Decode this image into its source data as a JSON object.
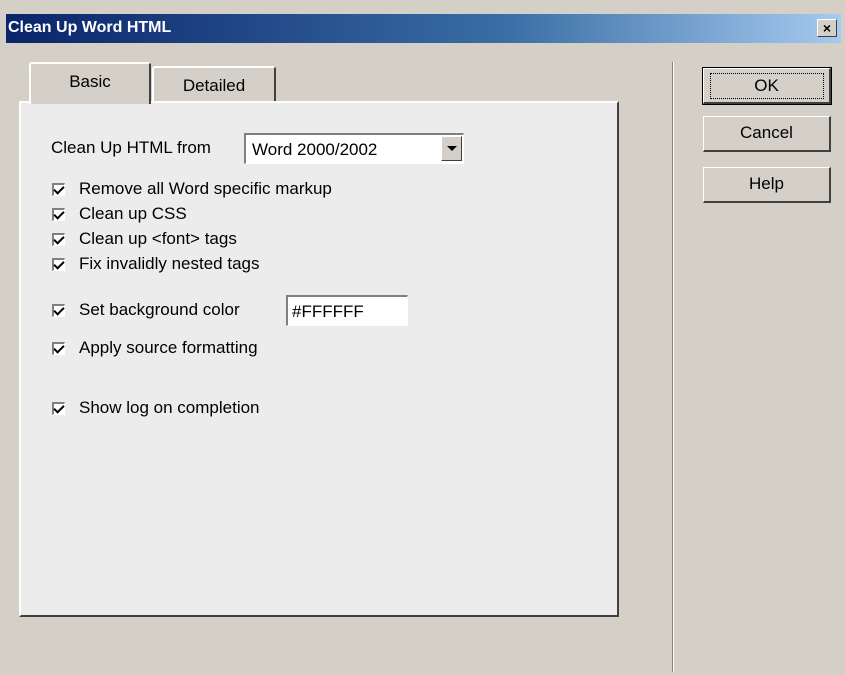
{
  "dialog": {
    "title": "Clean Up Word HTML",
    "close_label": "×"
  },
  "tabs": [
    {
      "label": "Basic",
      "active": true
    },
    {
      "label": "Detailed",
      "active": false
    }
  ],
  "basic": {
    "cleanup_from_label": "Clean Up HTML from",
    "cleanup_from_value": "Word 2000/2002",
    "options": [
      {
        "label": "Remove all Word specific markup",
        "checked": true
      },
      {
        "label": "Clean up CSS",
        "checked": true
      },
      {
        "label": "Clean up <font> tags",
        "checked": true
      },
      {
        "label": "Fix invalidly nested tags",
        "checked": true
      }
    ],
    "bg_color_label": "Set background color",
    "bg_color_value": "#FFFFFF",
    "apply_source_label": "Apply source formatting",
    "show_log_label": "Show log on completion"
  },
  "buttons": {
    "ok": "OK",
    "cancel": "Cancel",
    "help": "Help"
  }
}
